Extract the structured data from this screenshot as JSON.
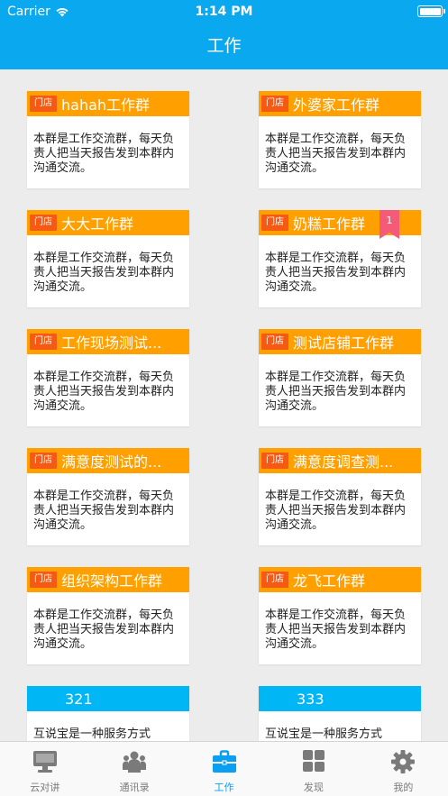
{
  "status_bar": {
    "carrier": "Carrier",
    "time": "1:14 PM"
  },
  "header": {
    "title": "工作"
  },
  "tag_label": "门店",
  "groups": [
    {
      "name": "hahah工作群",
      "desc": "本群是工作交流群，每天负责人把当天报告发到本群内沟通交流。"
    },
    {
      "name": "外婆家工作群",
      "desc": "本群是工作交流群，每天负责人把当天报告发到本群内沟通交流。"
    },
    {
      "name": "大大工作群",
      "desc": "本群是工作交流群，每天负责人把当天报告发到本群内沟通交流。"
    },
    {
      "name": "奶糕工作群",
      "desc": "本群是工作交流群，每天负责人把当天报告发到本群内沟通交流。",
      "badge": "1"
    },
    {
      "name": "工作现场测试...",
      "desc": "本群是工作交流群，每天负责人把当天报告发到本群内沟通交流。"
    },
    {
      "name": "测试店铺工作群",
      "desc": "本群是工作交流群，每天负责人把当天报告发到本群内沟通交流。"
    },
    {
      "name": "满意度测试的...",
      "desc": "本群是工作交流群，每天负责人把当天报告发到本群内沟通交流。"
    },
    {
      "name": "满意度调查测...",
      "desc": "本群是工作交流群，每天负责人把当天报告发到本群内沟通交流。"
    },
    {
      "name": "组织架构工作群",
      "desc": "本群是工作交流群，每天负责人把当天报告发到本群内沟通交流。"
    },
    {
      "name": "龙飞工作群",
      "desc": "本群是工作交流群，每天负责人把当天报告发到本群内沟通交流。"
    }
  ],
  "service_groups": [
    {
      "name": "321",
      "desc": "互说宝是一种服务方式"
    },
    {
      "name": "333",
      "desc": "互说宝是一种服务方式"
    }
  ],
  "tabs": [
    {
      "label": "云对讲",
      "icon": "monitor-icon",
      "active": false
    },
    {
      "label": "通讯录",
      "icon": "contacts-icon",
      "active": false
    },
    {
      "label": "工作",
      "icon": "briefcase-icon",
      "active": true
    },
    {
      "label": "发现",
      "icon": "grid-icon",
      "active": false
    },
    {
      "label": "我的",
      "icon": "gear-icon",
      "active": false
    }
  ],
  "colors": {
    "header": "#0aa8ef",
    "store_card_header": "#ff9f00",
    "store_tag": "#f55a14",
    "service_card_header": "#00b6f5",
    "badge": "#f35b77",
    "tab_active": "#0a9ff0",
    "tab_inactive": "#7a7a7a"
  }
}
